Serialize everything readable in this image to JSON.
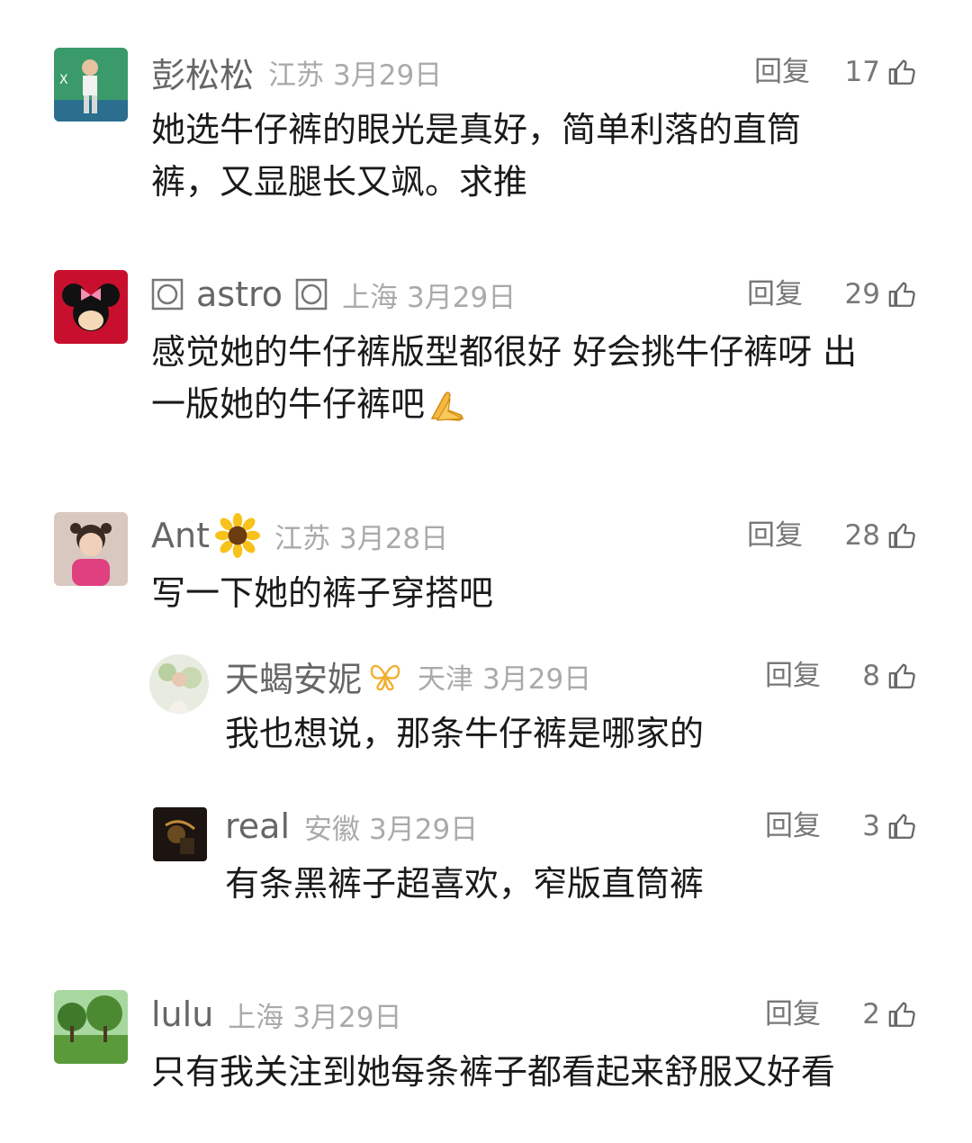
{
  "comments": [
    {
      "name": "彭松松",
      "location": "江苏",
      "date": "3月29日",
      "reply_label": "回复",
      "likes": "17",
      "text_lines": [
        "她选牛仔裤的眼光是真好，简单利落的直筒",
        "裤，又显腿长又飒。求推"
      ]
    },
    {
      "name": "astro",
      "name_prefix_icon": "square-circle-icon",
      "name_suffix_icon": "square-circle-icon",
      "location": "上海",
      "date": "3月29日",
      "reply_label": "回复",
      "likes": "29",
      "text_lines": [
        "感觉她的牛仔裤版型都很好 好会挑牛仔裤呀 出",
        "一版她的牛仔裤吧"
      ],
      "text_emoji": "pray-hands-icon"
    },
    {
      "name": "Ant",
      "name_suffix_icon": "sunflower-icon",
      "location": "江苏",
      "date": "3月28日",
      "reply_label": "回复",
      "likes": "28",
      "text_lines": [
        "写一下她的裤子穿搭吧"
      ],
      "replies": [
        {
          "name": "天蝎安妮",
          "name_suffix_icon": "butterfly-icon",
          "location": "天津",
          "date": "3月29日",
          "reply_label": "回复",
          "likes": "8",
          "text_lines": [
            "我也想说，那条牛仔裤是哪家的"
          ]
        },
        {
          "name": "real",
          "location": "安徽",
          "date": "3月29日",
          "reply_label": "回复",
          "likes": "3",
          "text_lines": [
            "有条黑裤子超喜欢，窄版直筒裤"
          ]
        }
      ]
    },
    {
      "name": "lulu",
      "location": "上海",
      "date": "3月29日",
      "reply_label": "回复",
      "likes": "2",
      "text_lines": [
        "只有我关注到她每条裤子都看起来舒服又好看"
      ]
    }
  ],
  "colors": {
    "name": "#666666",
    "meta": "#aaaaaa",
    "text": "#1a1a1a",
    "butterfly": "#f0b030"
  }
}
